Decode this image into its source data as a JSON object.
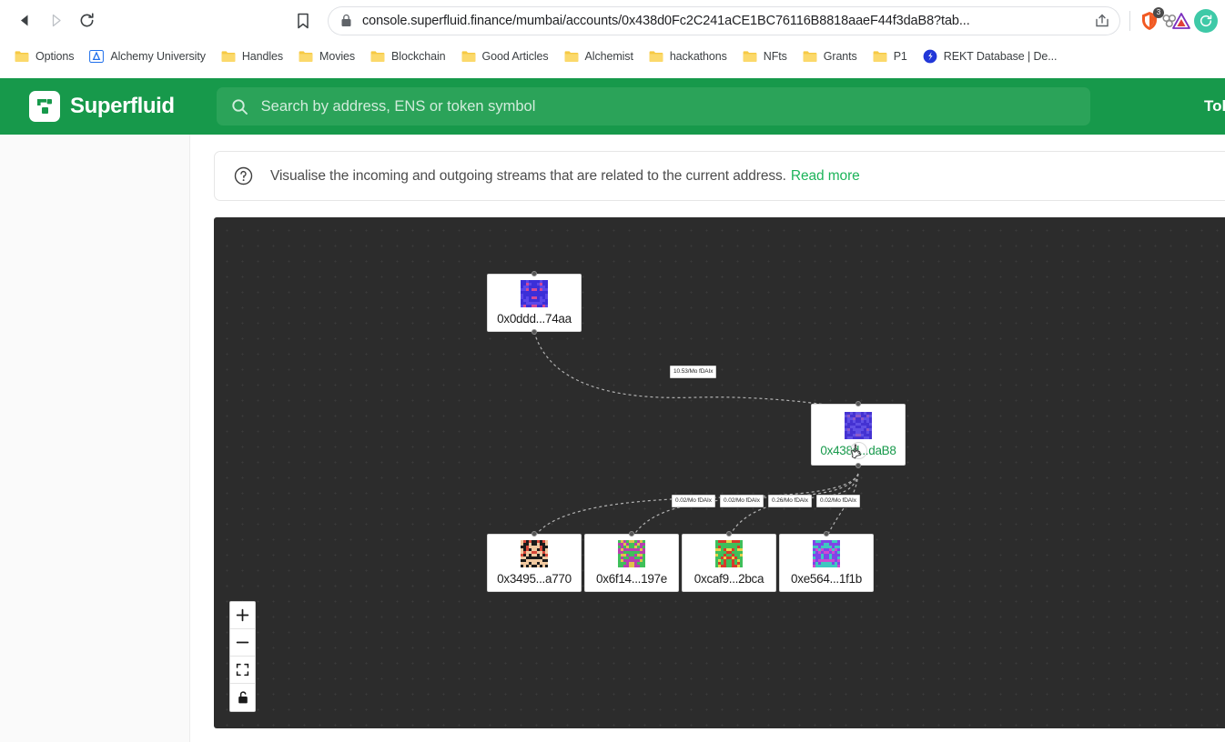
{
  "browser": {
    "back_label": "Back",
    "forward_label": "Forward",
    "reload_label": "Reload",
    "bookmark_label": "Bookmark this tab",
    "url": "console.superfluid.finance/mumbai/accounts/0x438d0Fc2C241aCE1BC76116B8818aaeF44f3daB8?tab...",
    "share_label": "Share this page",
    "extension_badge_count": "3",
    "bookmarks": [
      {
        "label": "Options",
        "icon": "folder-icon"
      },
      {
        "label": "Alchemy University",
        "icon": "alchemy-favicon"
      },
      {
        "label": "Handles",
        "icon": "folder-icon"
      },
      {
        "label": "Movies",
        "icon": "folder-icon"
      },
      {
        "label": "Blockchain",
        "icon": "folder-icon"
      },
      {
        "label": "Good Articles",
        "icon": "folder-icon"
      },
      {
        "label": "Alchemist",
        "icon": "folder-icon"
      },
      {
        "label": "hackathons",
        "icon": "folder-icon"
      },
      {
        "label": "NFts",
        "icon": "folder-icon"
      },
      {
        "label": "Grants",
        "icon": "folder-icon"
      },
      {
        "label": "P1",
        "icon": "folder-icon"
      },
      {
        "label": "REKT Database | De...",
        "icon": "rekt-favicon"
      }
    ]
  },
  "app_header": {
    "brand": "Superfluid",
    "search_placeholder": "Search by address, ENS or token symbol",
    "search_value": "",
    "nav_right_label": "Tok",
    "brand_color": "#17994b",
    "search_bg_color": "#2ba359"
  },
  "banner": {
    "text": "Visualise the incoming and outgoing streams that are related to the current address.",
    "link_label": "Read more",
    "link_color": "#1db45a",
    "icon": "question-circle-icon"
  },
  "graph": {
    "background_color": "#2c2c2c",
    "nodes": [
      {
        "id": "n-sender",
        "address": "0x0ddd...74aa",
        "role": "sender",
        "highlight": false
      },
      {
        "id": "n-center",
        "address": "0x438d...daB8",
        "role": "current",
        "highlight": true
      },
      {
        "id": "n-r1",
        "address": "0x3495...a770",
        "role": "receiver",
        "highlight": false
      },
      {
        "id": "n-r2",
        "address": "0x6f14...197e",
        "role": "receiver",
        "highlight": false
      },
      {
        "id": "n-r3",
        "address": "0xcaf9...2bca",
        "role": "receiver",
        "highlight": false
      },
      {
        "id": "n-r4",
        "address": "0xe564...1f1b",
        "role": "receiver",
        "highlight": false
      }
    ],
    "edges": [
      {
        "from": "n-sender",
        "to": "n-center",
        "label": "10.53/Mo fDAIx"
      },
      {
        "from": "n-center",
        "to": "n-r1",
        "label": "0.02/Mo fDAIx"
      },
      {
        "from": "n-center",
        "to": "n-r2",
        "label": "0.02/Mo fDAIx"
      },
      {
        "from": "n-center",
        "to": "n-r3",
        "label": "0.26/Mo fDAIx"
      },
      {
        "from": "n-center",
        "to": "n-r4",
        "label": "0.02/Mo fDAIx"
      }
    ],
    "controls": [
      {
        "name": "zoom-in",
        "glyph": "+"
      },
      {
        "name": "zoom-out",
        "glyph": "–"
      },
      {
        "name": "fit-view",
        "glyph": "fit"
      },
      {
        "name": "toggle-lock",
        "glyph": "lock"
      }
    ]
  }
}
